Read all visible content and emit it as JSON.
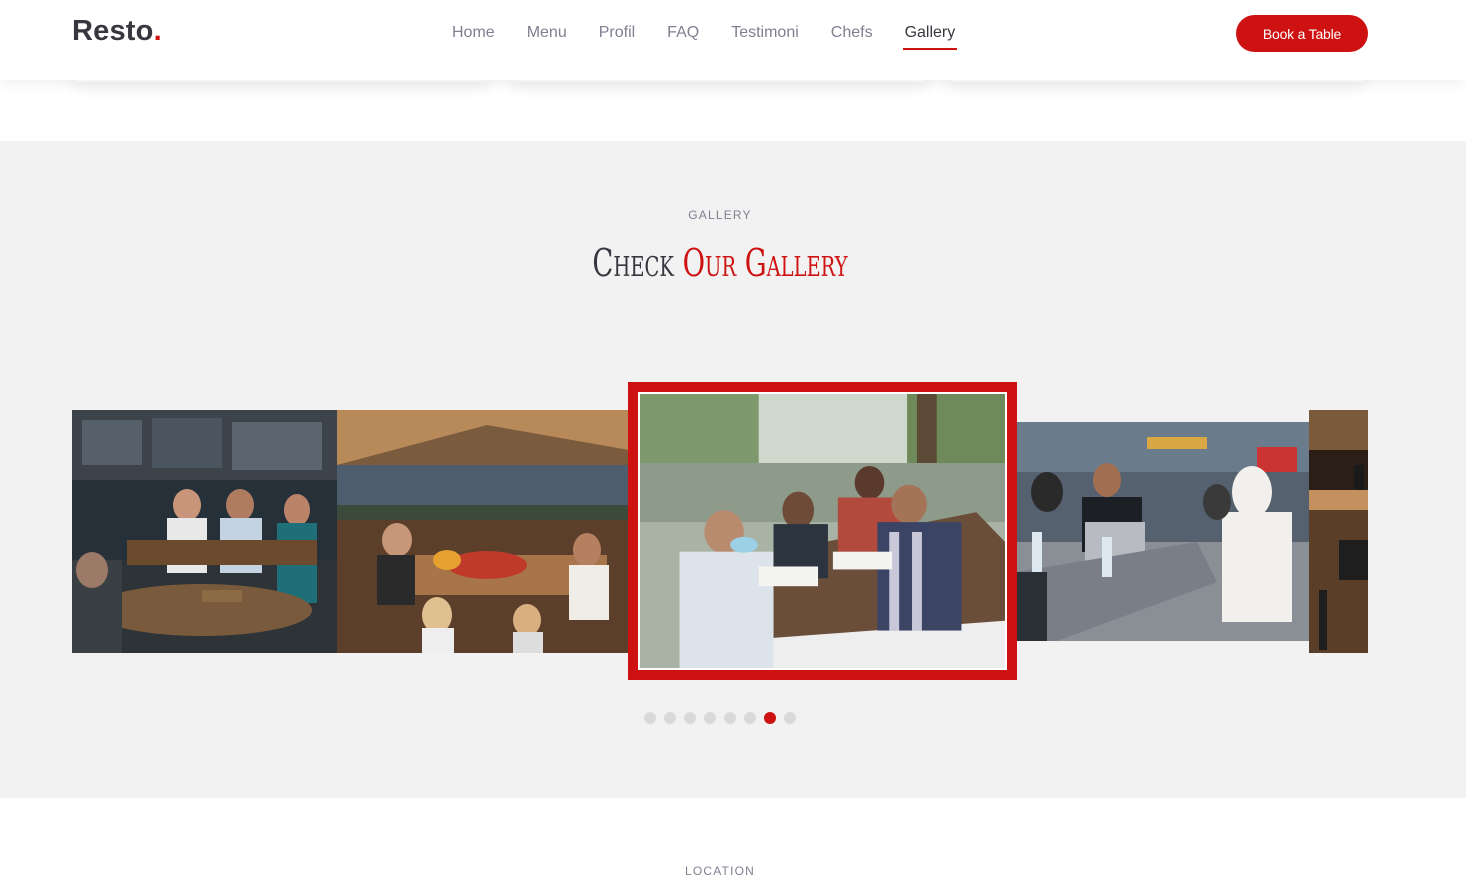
{
  "brand": {
    "name": "Resto",
    "dot": ".",
    "accent_color": "#ce1212"
  },
  "nav": {
    "items": [
      {
        "label": "Home"
      },
      {
        "label": "Menu"
      },
      {
        "label": "Profil"
      },
      {
        "label": "FAQ"
      },
      {
        "label": "Testimoni"
      },
      {
        "label": "Chefs"
      },
      {
        "label": "Gallery",
        "active": true
      }
    ],
    "cta": "Book a Table"
  },
  "gallery": {
    "subtitle": "GALLERY",
    "title_part1": "Check",
    "title_part2": "Our Gallery",
    "slides": [
      {
        "name": "bar-friends-photo",
        "active": false
      },
      {
        "name": "outdoor-dinner-photo",
        "active": false
      },
      {
        "name": "group-discussion-photo",
        "active": true
      },
      {
        "name": "cafeteria-students-photo",
        "active": false
      },
      {
        "name": "restaurant-interior-photo",
        "active": false
      }
    ],
    "pagination": {
      "total": 8,
      "current": 7
    }
  },
  "location": {
    "subtitle": "LOCATION"
  }
}
